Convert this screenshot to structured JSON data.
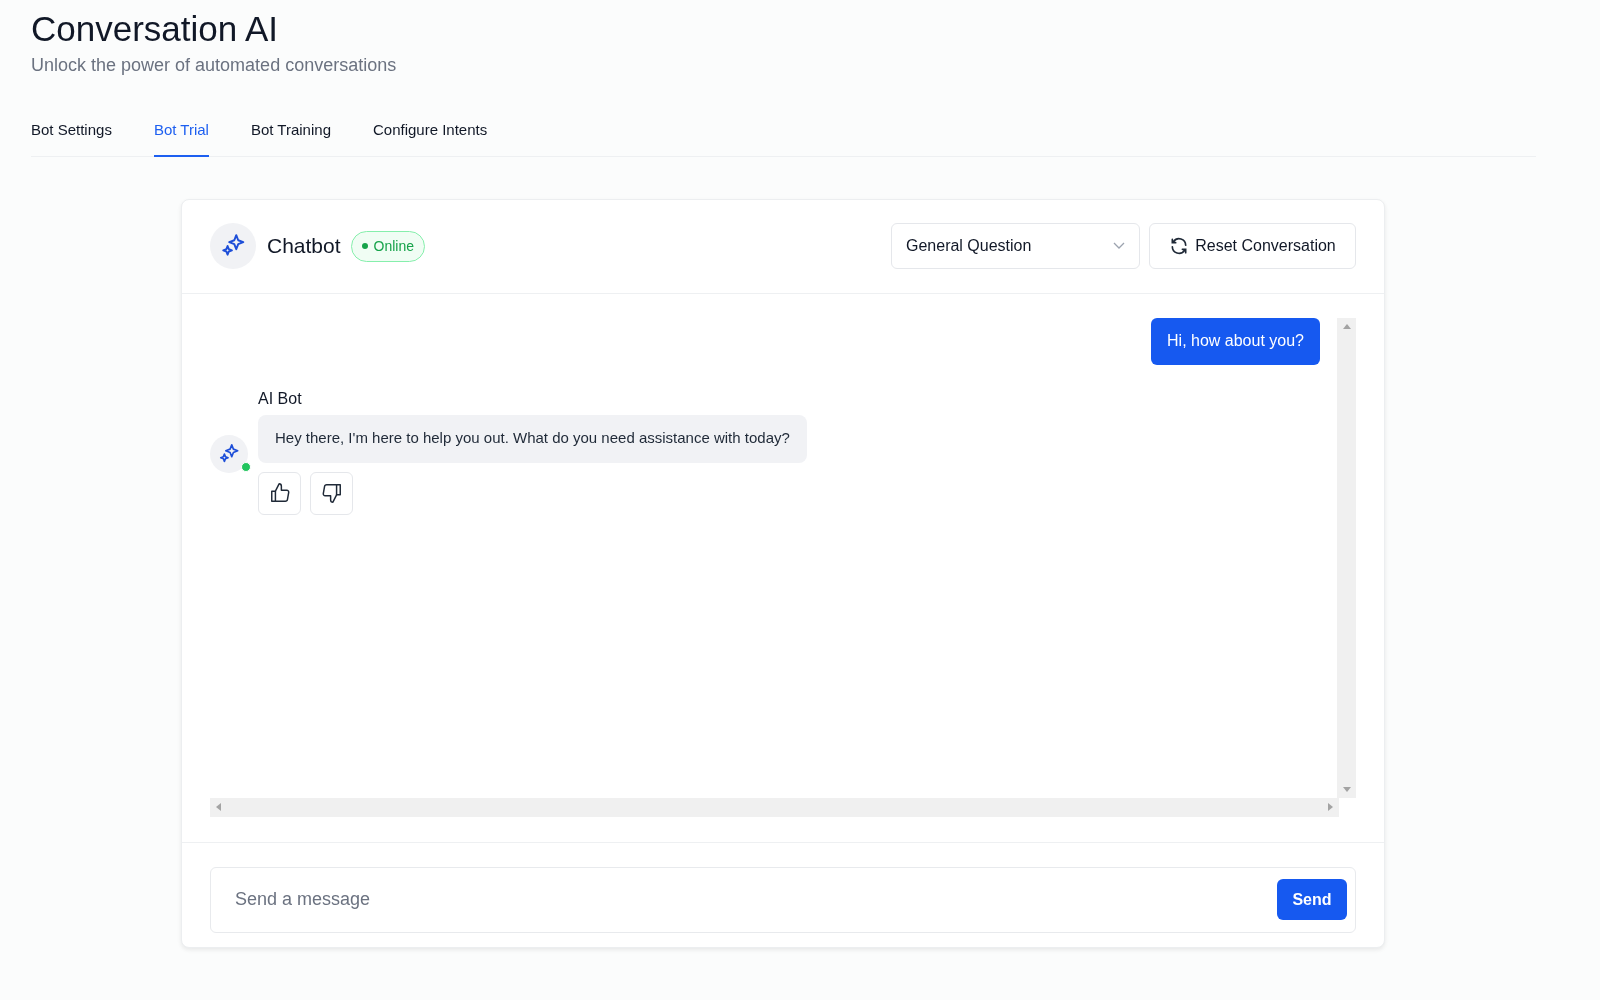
{
  "header": {
    "title": "Conversation AI",
    "subtitle": "Unlock the power of automated conversations"
  },
  "tabs": [
    {
      "label": "Bot Settings",
      "selected": false
    },
    {
      "label": "Bot Trial",
      "selected": true
    },
    {
      "label": "Bot Training",
      "selected": false
    },
    {
      "label": "Configure Intents",
      "selected": false
    }
  ],
  "chat": {
    "bot_name": "Chatbot",
    "status": "Online",
    "intent_select": "General Question",
    "reset_button": "Reset Conversation",
    "messages": [
      {
        "kind": "user",
        "text": "Hi, how about you?"
      },
      {
        "kind": "bot",
        "sender": "AI Bot",
        "text": "Hey there, I'm here to help you out. What do you need assistance with today?",
        "online": true
      }
    ],
    "composer": {
      "placeholder": "Send a message",
      "send_button": "Send"
    }
  }
}
